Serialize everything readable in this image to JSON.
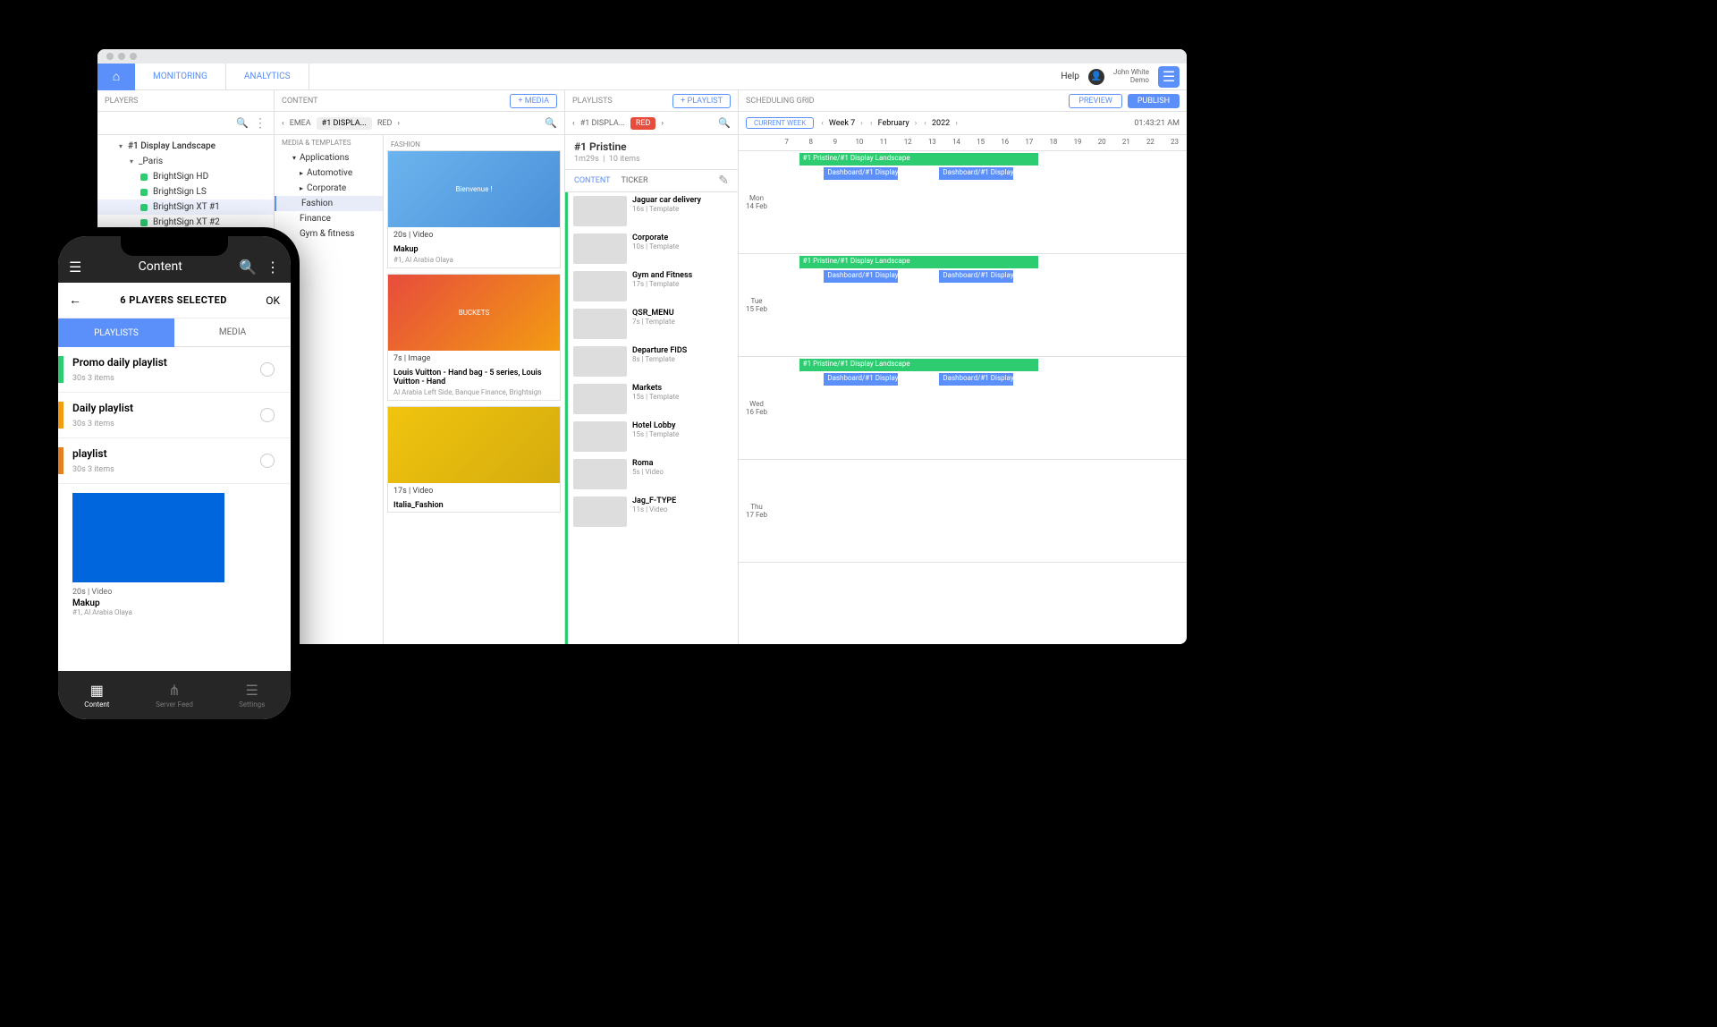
{
  "topbar": {
    "tabs": [
      "MONITORING",
      "ANALYTICS"
    ],
    "help": "Help",
    "user_name": "John White",
    "user_sub": "Demo"
  },
  "players": {
    "header": "PLAYERS",
    "tree": {
      "root": "#1 Display Landscape",
      "group": "_Paris",
      "items": [
        "BrightSign HD",
        "BrightSign LS",
        "BrightSign XT #1",
        "BrightSign XT #2"
      ]
    }
  },
  "content": {
    "header": "CONTENT",
    "add": "+ MEDIA",
    "crumbs": [
      "EMEA",
      "#1 DISPLA...",
      "RED"
    ],
    "cat_header": "MEDIA & TEMPLATES",
    "categories": {
      "root": "Applications",
      "items": [
        "Automotive",
        "Corporate",
        "Fashion",
        "Finance",
        "Gym & fitness"
      ],
      "selected": "Fashion"
    },
    "media_header": "FASHION",
    "media": [
      {
        "preview": "Bienvenue !",
        "meta": "20s | Video",
        "title": "Makup",
        "sub": "#1, Al Arabia Olaya"
      },
      {
        "preview": "BUCKETS",
        "meta": "7s | Image",
        "title": "Louis Vuitton - Hand bag - 5 series, Louis Vuitton - Hand",
        "sub": "Al Arabia Left Side, Banque Finance, Brightsign"
      },
      {
        "preview": "",
        "meta": "17s | Video",
        "title": "Italia_Fashion",
        "sub": ""
      }
    ]
  },
  "playlists": {
    "header": "PLAYLISTS",
    "add": "+ PLAYLIST",
    "crumbs": [
      "#1 DISPLA...",
      "RED"
    ],
    "name": "#1 Pristine",
    "duration": "1m29s",
    "count": "10 items",
    "tabs": [
      "CONTENT",
      "TICKER"
    ],
    "items": [
      {
        "title": "Jaguar car delivery",
        "meta": "16s | Template"
      },
      {
        "title": "Corporate",
        "meta": "10s | Template"
      },
      {
        "title": "Gym and Fitness",
        "meta": "17s | Template"
      },
      {
        "title": "QSR_MENU",
        "meta": "7s | Template"
      },
      {
        "title": "Departure FIDS",
        "meta": "8s | Template"
      },
      {
        "title": "Markets",
        "meta": "15s | Template"
      },
      {
        "title": "Hotel Lobby",
        "meta": "15s | Template"
      },
      {
        "title": "Roma",
        "meta": "5s | Video"
      },
      {
        "title": "Jag_F-TYPE",
        "meta": "11s | Video"
      }
    ]
  },
  "schedule": {
    "header": "SCHEDULING GRID",
    "preview": "PREVIEW",
    "publish": "PUBLISH",
    "current": "CURRENT WEEK",
    "week": "Week 7",
    "month": "February",
    "year": "2022",
    "clock": "01:43:21 AM",
    "hours": [
      "7",
      "8",
      "9",
      "10",
      "11",
      "12",
      "13",
      "14",
      "15",
      "16",
      "17",
      "18",
      "19",
      "20",
      "21",
      "22",
      "23"
    ],
    "days": [
      {
        "d": "Mon",
        "n": "14 Feb"
      },
      {
        "d": "Tue",
        "n": "15 Feb"
      },
      {
        "d": "Wed",
        "n": "16 Feb"
      },
      {
        "d": "Thu",
        "n": "17 Feb"
      }
    ],
    "ev_green": "#1 Pristine/#1 Display Landscape",
    "ev_blue": "Dashboard/#1 Display"
  },
  "phone": {
    "title": "Content",
    "selection": "6 PLAYERS SELECTED",
    "ok": "OK",
    "tabs": [
      "PLAYLISTS",
      "MEDIA"
    ],
    "playlists": [
      {
        "title": "Promo daily playlist",
        "meta": "30s    3 items",
        "color": "#2ecc71"
      },
      {
        "title": "Daily playlist",
        "meta": "30s    3 items",
        "color": "#f39c12"
      },
      {
        "title": "playlist",
        "meta": "30s    3 items",
        "color": "#e67e22"
      }
    ],
    "media": {
      "meta": "20s | Video",
      "title": "Makup",
      "sub": "#1, Al Arabia Olaya"
    },
    "nav": [
      "Content",
      "Server Feed",
      "Settings"
    ]
  }
}
